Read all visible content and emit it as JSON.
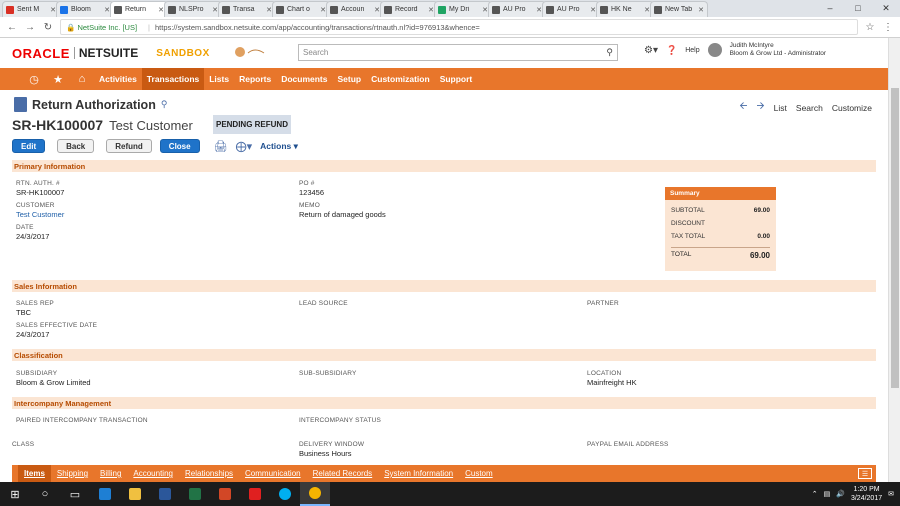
{
  "browser": {
    "tabs": [
      {
        "label": "Sent M",
        "color": "#d93025",
        "active": false
      },
      {
        "label": "Bloom",
        "color": "#1a73e8",
        "active": false
      },
      {
        "label": "Return",
        "color": "#555555",
        "active": true
      },
      {
        "label": "NLSPro",
        "color": "#555555",
        "active": false
      },
      {
        "label": "Transa",
        "color": "#555555",
        "active": false
      },
      {
        "label": "Chart o",
        "color": "#555555",
        "active": false
      },
      {
        "label": "Accoun",
        "color": "#555555",
        "active": false
      },
      {
        "label": "Record",
        "color": "#555555",
        "active": false
      },
      {
        "label": "My Dri",
        "color": "#1fa463",
        "active": false
      },
      {
        "label": "AU Pro",
        "color": "#555555",
        "active": false
      },
      {
        "label": "AU Pro",
        "color": "#555555",
        "active": false
      },
      {
        "label": "HK Ne",
        "color": "#555555",
        "active": false
      },
      {
        "label": "New Tab",
        "color": "#555555",
        "active": false
      }
    ],
    "site_name": "NetSuite Inc. [US]",
    "url": "https://system.sandbox.netsuite.com/app/accounting/transactions/rtnauth.nl?id=976913&whence="
  },
  "header": {
    "logo_oracle": "ORACLE",
    "logo_netsuite": "NETSUITE",
    "sandbox": "SANDBOX",
    "search_placeholder": "Search",
    "help": "Help",
    "user_name": "Judith McIntyre",
    "user_role": "Bloom & Grow Ltd - Administrator"
  },
  "menu": [
    "Activities",
    "Transactions",
    "Lists",
    "Reports",
    "Documents",
    "Setup",
    "Customization",
    "Support"
  ],
  "menu_active": "Transactions",
  "record": {
    "type_title": "Return Authorization",
    "number": "SR-HK100007",
    "customer_name": "Test Customer",
    "status": "PENDING REFUND",
    "nav": {
      "list": "List",
      "search": "Search",
      "customize": "Customize"
    }
  },
  "buttons": {
    "edit": "Edit",
    "back": "Back",
    "refund": "Refund",
    "close": "Close",
    "actions": "Actions"
  },
  "sections": {
    "primary": "Primary Information",
    "sales": "Sales Information",
    "classification": "Classification",
    "intercompany": "Intercompany Management"
  },
  "primary": {
    "rtn_auth_label": "RTN. AUTH. #",
    "rtn_auth_value": "SR-HK100007",
    "customer_label": "CUSTOMER",
    "customer_value": "Test Customer",
    "date_label": "DATE",
    "date_value": "24/3/2017",
    "po_label": "PO #",
    "po_value": "123456",
    "memo_label": "MEMO",
    "memo_value": "Return of damaged goods"
  },
  "summary": {
    "title": "Summary",
    "subtotal_label": "SUBTOTAL",
    "subtotal_value": "69.00",
    "discount_label": "DISCOUNT",
    "tax_label": "TAX TOTAL",
    "tax_value": "0.00",
    "total_label": "TOTAL",
    "total_value": "69.00"
  },
  "sales": {
    "rep_label": "SALES REP",
    "rep_value": "TBC",
    "lead_label": "LEAD SOURCE",
    "partner_label": "PARTNER",
    "eff_date_label": "SALES EFFECTIVE DATE",
    "eff_date_value": "24/3/2017"
  },
  "classification": {
    "subsidiary_label": "SUBSIDIARY",
    "subsidiary_value": "Bloom & Grow Limited",
    "subsub_label": "SUB-SUBSIDIARY",
    "location_label": "LOCATION",
    "location_value": "Mainfreight HK"
  },
  "intercompany": {
    "paired_label": "PAIRED INTERCOMPANY TRANSACTION",
    "status_label": "INTERCOMPANY STATUS",
    "class_label": "CLASS",
    "delivery_label": "DELIVERY WINDOW",
    "delivery_value": "Business Hours",
    "paypal_label": "PAYPAL EMAIL ADDRESS"
  },
  "subtabs": [
    "Items",
    "Shipping",
    "Billing",
    "Accounting",
    "Relationships",
    "Communication",
    "Related Records",
    "System Information",
    "Custom"
  ],
  "taskbar": {
    "time": "1:20 PM",
    "date": "3/24/2017"
  }
}
